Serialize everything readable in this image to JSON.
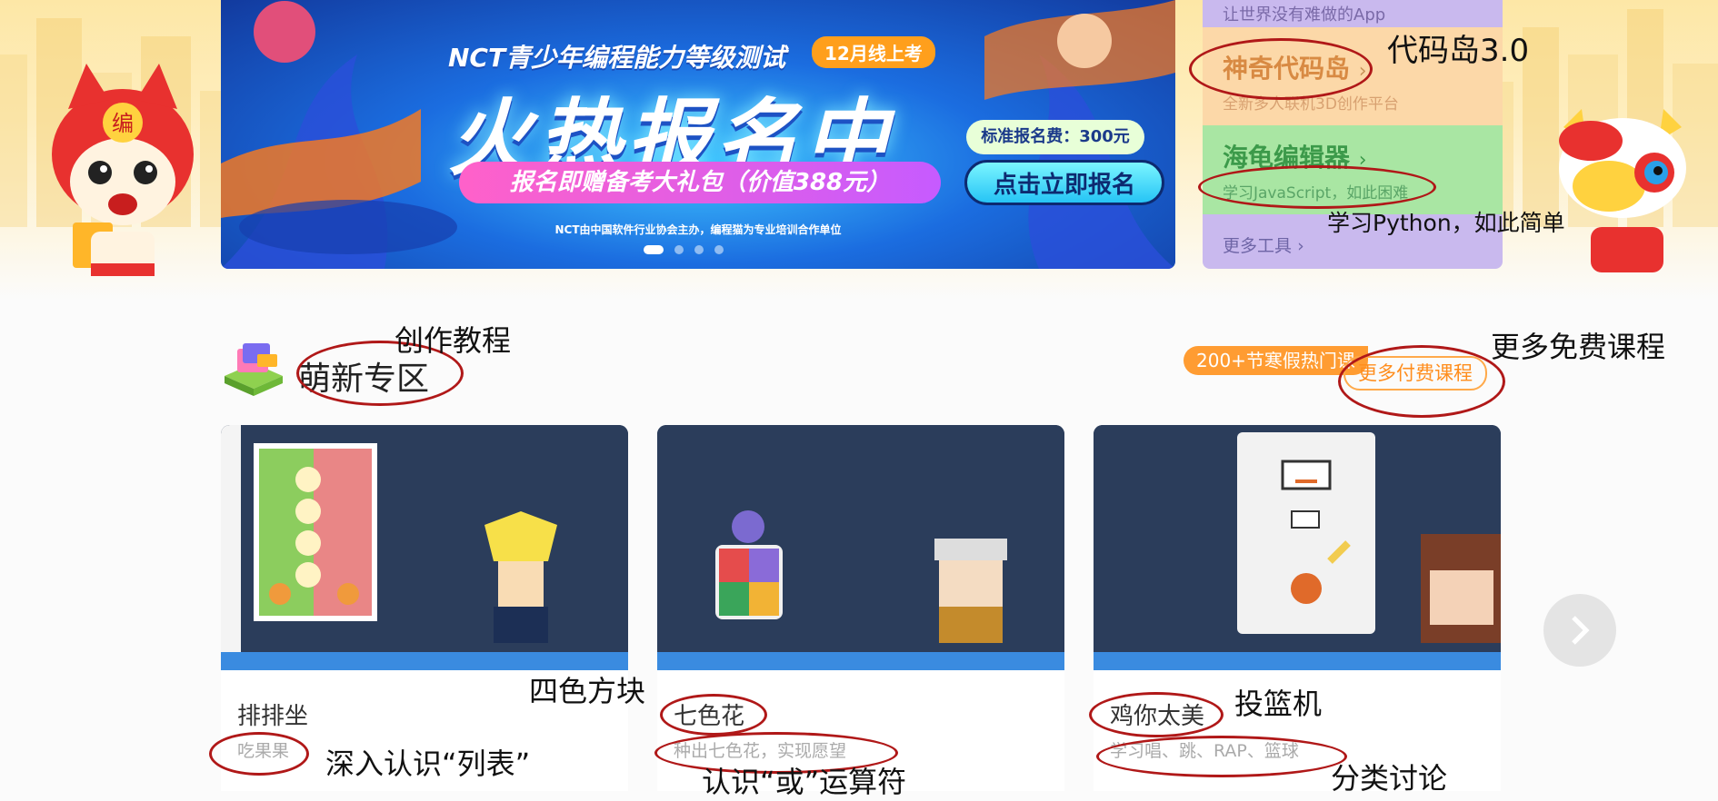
{
  "banner": {
    "headline": "NCT青少年编程能力等级测试",
    "badge": "12月线上考",
    "title": "火热报名中",
    "gift": "报名即赠备考大礼包（价值388元）",
    "fee": "标准报名费：300元",
    "cta": "点击立即报名",
    "footnote": "NCT由中国软件行业协会主办，编程猫为专业培训合作单位"
  },
  "mascot": {
    "badge_char": "编"
  },
  "side_tools": {
    "slogan": "让世界没有难做的App",
    "tool1": {
      "title": "神奇代码岛",
      "subtitle": "全新多人联机3D创作平台",
      "chevron": "›"
    },
    "tool2": {
      "title": "海龟编辑器",
      "subtitle": "学习JavaScript，如此困难",
      "chevron": "›"
    },
    "more": "更多工具",
    "more_chevron": "›"
  },
  "section": {
    "title": "萌新专区",
    "hot_pill": "200+节寒假热门课",
    "more_paid": "更多付费课程"
  },
  "cards": [
    {
      "title": "排排坐",
      "desc": "吃果果"
    },
    {
      "title": "七色花",
      "desc": "种出七色花，实现愿望"
    },
    {
      "title": "鸡你太美",
      "desc": "学习唱、跳、RAP、篮球"
    }
  ],
  "annotations": {
    "daima": "代码岛3.0",
    "python": "学习Python，如此简单",
    "tutorial": "创作教程",
    "free": "更多免费课程",
    "sise": "四色方块",
    "list": "深入认识“列表”",
    "or": "认识“或”运算符",
    "basket": "投篮机",
    "classify": "分类讨论"
  },
  "colors": {
    "ink": "#b01818",
    "orange": "#ff9c32",
    "purple_row": "#c9b9ee",
    "peach_row": "#fcd8a8",
    "green_row": "#a9e6a3"
  }
}
